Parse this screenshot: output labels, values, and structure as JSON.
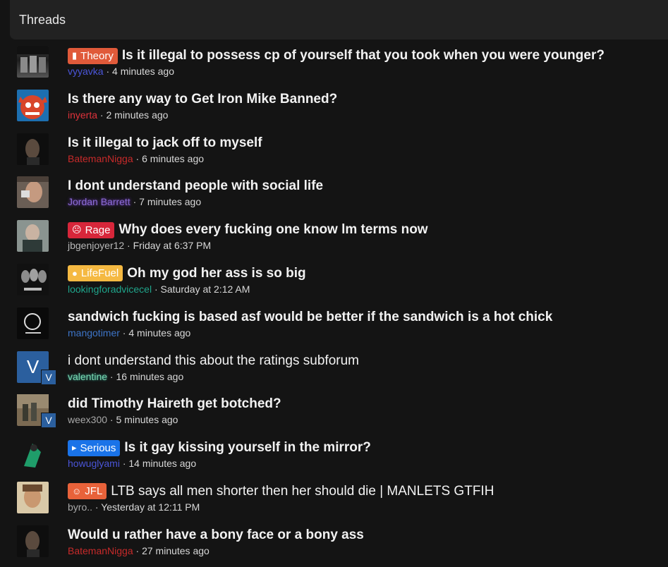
{
  "header": {
    "title": "Threads"
  },
  "threads": [
    {
      "prefix": {
        "label": "Theory",
        "color": "#e05a3a",
        "icon": "book-icon"
      },
      "title": "Is it illegal to possess cp of yourself that you took when you were younger?",
      "user": "vyyavka",
      "time": "4 minutes ago"
    },
    {
      "prefix": null,
      "title": "Is there any way to Get Iron Mike Banned?",
      "user": "inyerta",
      "time": "2 minutes ago"
    },
    {
      "prefix": null,
      "title": "Is it illegal to jack off to myself",
      "user": "BatemanNigga",
      "time": "6 minutes ago"
    },
    {
      "prefix": null,
      "title": "I dont understand people with social life",
      "user": "Jordan Barrett",
      "time": "7 minutes ago"
    },
    {
      "prefix": {
        "label": "Rage",
        "color": "#d7263a",
        "icon": "angry-face-icon"
      },
      "title": "Why does every fucking one know lm terms now",
      "user": "jbgenjoyer12",
      "time": "Friday at 6:37 PM"
    },
    {
      "prefix": {
        "label": "LifeFuel",
        "color": "#f5b942",
        "icon": "lightbulb-icon"
      },
      "title": "Oh my god her ass is so big",
      "user": "lookingforadvicecel",
      "time": "Saturday at 2:12 AM"
    },
    {
      "prefix": null,
      "title": "sandwich fucking is based asf would be better if the sandwich is a hot chick",
      "user": "mangotimer",
      "time": "4 minutes ago"
    },
    {
      "prefix": null,
      "title": "i dont understand this about the ratings subforum",
      "user": "valentine",
      "time": "16 minutes ago",
      "avatar_letter": "V"
    },
    {
      "prefix": null,
      "title": "did Timothy Haireth get botched?",
      "user": "weex300",
      "time": "5 minutes ago",
      "avatar_badge": "V"
    },
    {
      "prefix": {
        "label": "Serious",
        "color": "#1a73e8",
        "icon": "megaphone-icon"
      },
      "title": "Is it gay kissing yourself in the mirror?",
      "user": "howuglyami",
      "time": "14 minutes ago"
    },
    {
      "prefix": {
        "label": "JFL",
        "color": "#e8623a",
        "icon": "laugh-face-icon"
      },
      "title": "LTB says all men shorter then her should die | MANLETS GTFIH",
      "user": "byro..",
      "time": "Yesterday at 12:11 PM"
    },
    {
      "prefix": null,
      "title": "Would u rather have a bony face or a bony ass",
      "user": "BatemanNigga",
      "time": "27 minutes ago"
    }
  ]
}
